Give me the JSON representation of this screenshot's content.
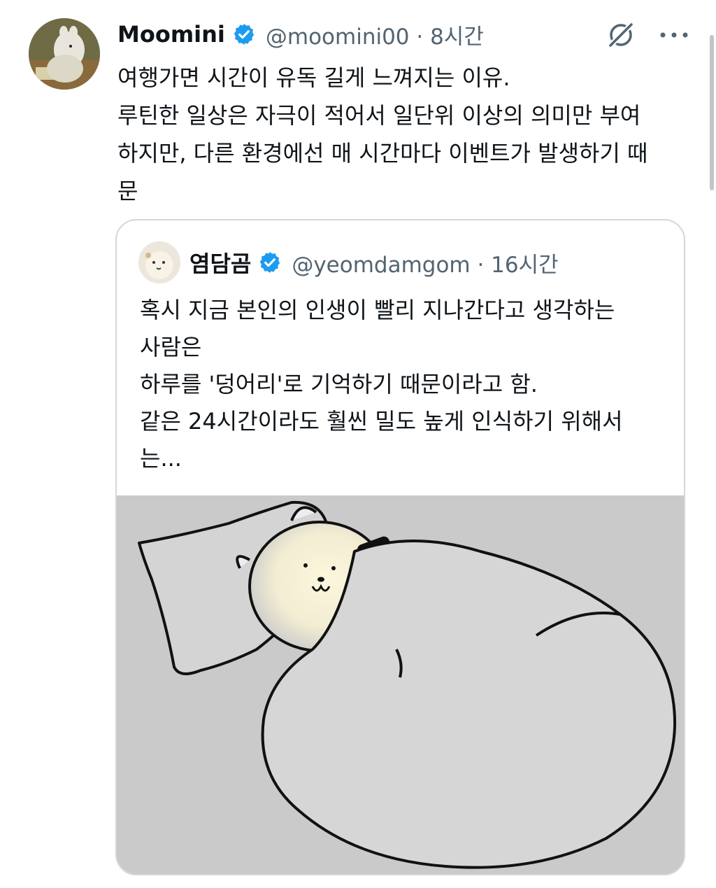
{
  "tweet": {
    "author_name": "Moomini",
    "handle_time": "@moomini00 · 8시간",
    "lines": [
      "여행가면 시간이 유독 길게 느껴지는 이유.",
      "루틴한 일상은 자극이 적어서 일단위 이상의 의미만 부여",
      "하지만, 다른 환경에선 매 시간마다 이벤트가 발생하기 때",
      "문"
    ],
    "verified_color": "#1d9bf0",
    "icons": [
      "grok-icon",
      "more-icon"
    ]
  },
  "quote": {
    "author_name": "염담곰",
    "handle_time": "@yeomdamgom · 16시간",
    "lines": [
      "혹시 지금 본인의 인생이 빨리 지나간다고 생각하는",
      "사람은",
      "하루를 '덩어리'로 기억하기 때문이라고 함.",
      "같은 24시간이라도 훨씬 밀도 높게 인식하기 위해서",
      "는..."
    ]
  }
}
